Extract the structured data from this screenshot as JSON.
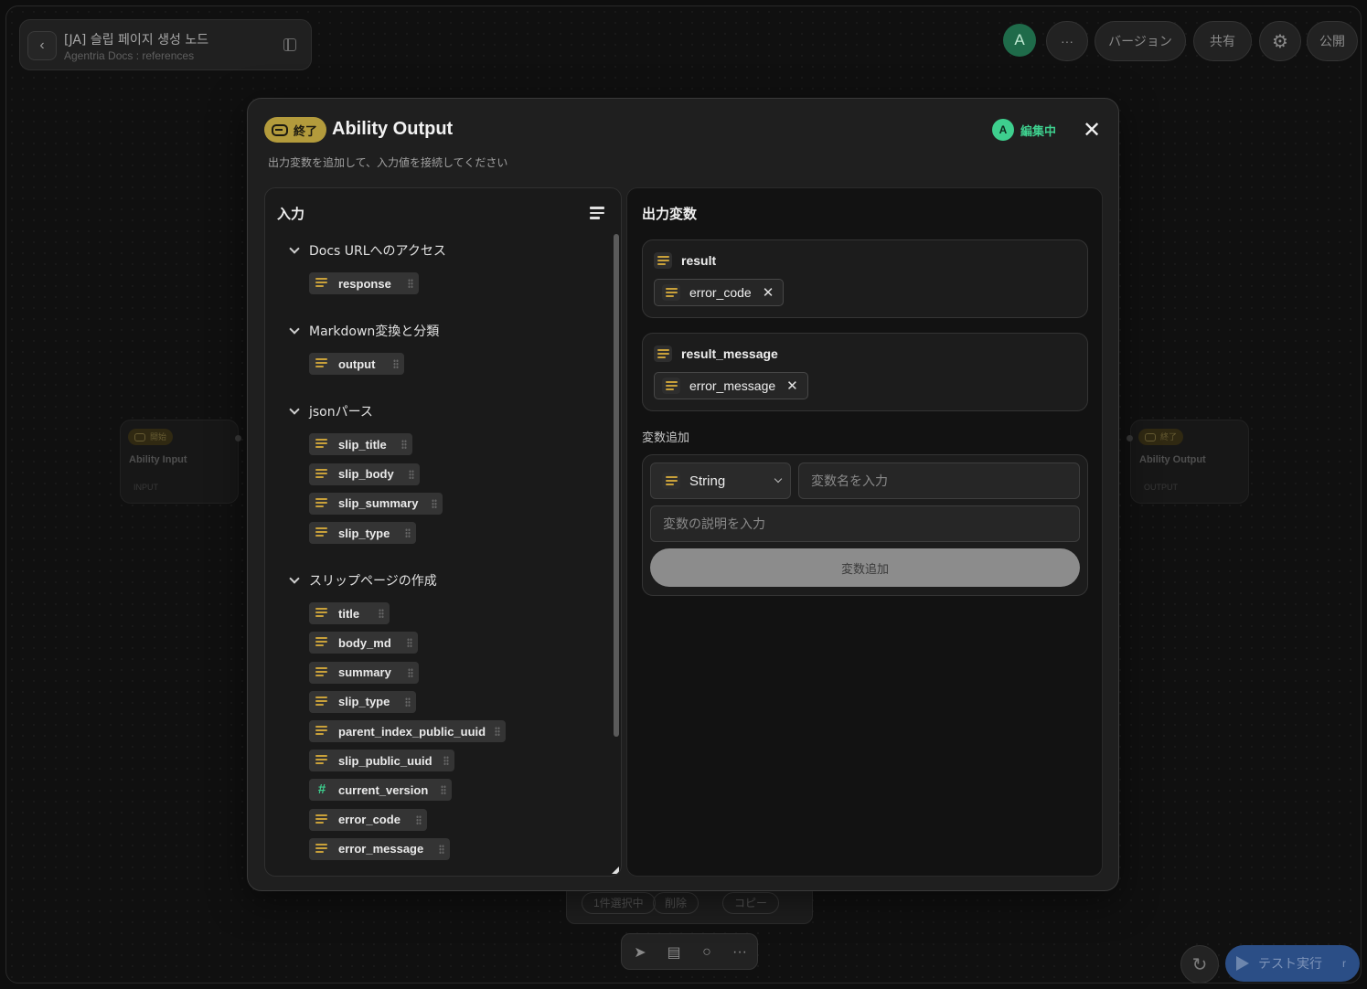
{
  "workflow": {
    "title": "[JA] 슬립 페이지 생성 노드",
    "subtitle": "Agentria Docs : references"
  },
  "toolbar": {
    "avatar_letter": "A",
    "more_label": "···",
    "version_label": "バージョン",
    "share_label": "共有",
    "publish_label": "公開"
  },
  "canvas_nodes": {
    "input_node": {
      "badge": "開始",
      "title": "Ability Input",
      "label": "INPUT"
    },
    "output_node": {
      "badge": "終了",
      "title": "Ability Output",
      "label": "OUTPUT"
    }
  },
  "selection_bar": {
    "count_label": "1件選択中",
    "delete_label": "削除",
    "copy_label": "コピー"
  },
  "bottom_tools": [
    "pointer",
    "notes",
    "comment",
    "more"
  ],
  "test_run": {
    "label": "テスト実行",
    "shortcut": "r"
  },
  "modal": {
    "badge": "終了",
    "title": "Ability Output",
    "subtitle": "出力変数を追加して、入力値を接続してください",
    "editor": {
      "avatar": "A",
      "status": "編集中"
    },
    "input_panel": {
      "title": "入力",
      "groups": [
        {
          "name": "Docs URLへのアクセス",
          "vars": [
            {
              "name": "response",
              "type": "string"
            }
          ]
        },
        {
          "name": "Markdown変換と分類",
          "vars": [
            {
              "name": "output",
              "type": "string"
            }
          ]
        },
        {
          "name": "jsonパース",
          "vars": [
            {
              "name": "slip_title",
              "type": "string"
            },
            {
              "name": "slip_body",
              "type": "string"
            },
            {
              "name": "slip_summary",
              "type": "string"
            },
            {
              "name": "slip_type",
              "type": "string"
            }
          ]
        },
        {
          "name": "スリップページの作成",
          "vars": [
            {
              "name": "title",
              "type": "string"
            },
            {
              "name": "body_md",
              "type": "string"
            },
            {
              "name": "summary",
              "type": "string"
            },
            {
              "name": "slip_type",
              "type": "string"
            },
            {
              "name": "parent_index_public_uuid",
              "type": "string"
            },
            {
              "name": "slip_public_uuid",
              "type": "string"
            },
            {
              "name": "current_version",
              "type": "number"
            },
            {
              "name": "error_code",
              "type": "string"
            },
            {
              "name": "error_message",
              "type": "string"
            }
          ]
        }
      ]
    },
    "output_panel": {
      "title": "出力変数",
      "outputs": [
        {
          "name": "result",
          "bound": "error_code"
        },
        {
          "name": "result_message",
          "bound": "error_message"
        }
      ],
      "add_section_label": "変数追加",
      "type_select": "String",
      "name_placeholder": "変数名を入力",
      "desc_placeholder": "変数の説明を入力",
      "add_button": "変数追加"
    }
  },
  "colors": {
    "accent_gold": "#b39b3c",
    "editing_green": "#3ecf8e",
    "string_icon": "#c9a13a",
    "number_icon": "#3ecf8e",
    "test_button": "#2b4e86"
  }
}
